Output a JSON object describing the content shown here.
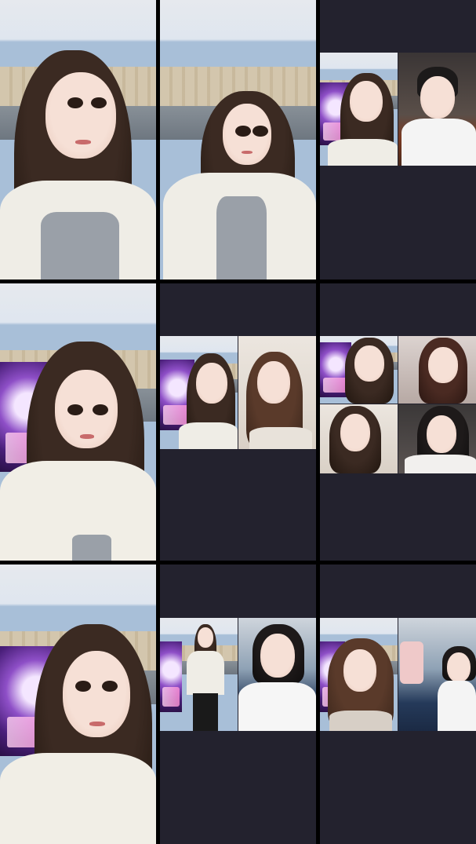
{
  "layout": {
    "title": ""
  },
  "tiles": [
    {
      "id": 1,
      "kind": "single-stream",
      "scene": "bluewall"
    },
    {
      "id": 2,
      "kind": "single-stream",
      "scene": "bluewall"
    },
    {
      "id": 3,
      "kind": "multi-guest-2",
      "scenes": [
        "bluewall",
        "studio"
      ]
    },
    {
      "id": 4,
      "kind": "single-stream",
      "scene": "bluewall"
    },
    {
      "id": 5,
      "kind": "multi-guest-2",
      "scenes": [
        "bluewall",
        "white"
      ]
    },
    {
      "id": 6,
      "kind": "multi-guest-4",
      "scenes": [
        "bluewall",
        "pink",
        "white",
        "dark"
      ]
    },
    {
      "id": 7,
      "kind": "single-stream",
      "scene": "bluewall"
    },
    {
      "id": 8,
      "kind": "multi-guest-2",
      "scenes": [
        "bluewall",
        "closet"
      ]
    },
    {
      "id": 9,
      "kind": "multi-guest-2",
      "scenes": [
        "bluewall",
        "closet"
      ]
    }
  ],
  "colors": {
    "grid_bg": "#000000",
    "empty_tile": "#23222e",
    "banner_accent": "#8e4fc7"
  }
}
